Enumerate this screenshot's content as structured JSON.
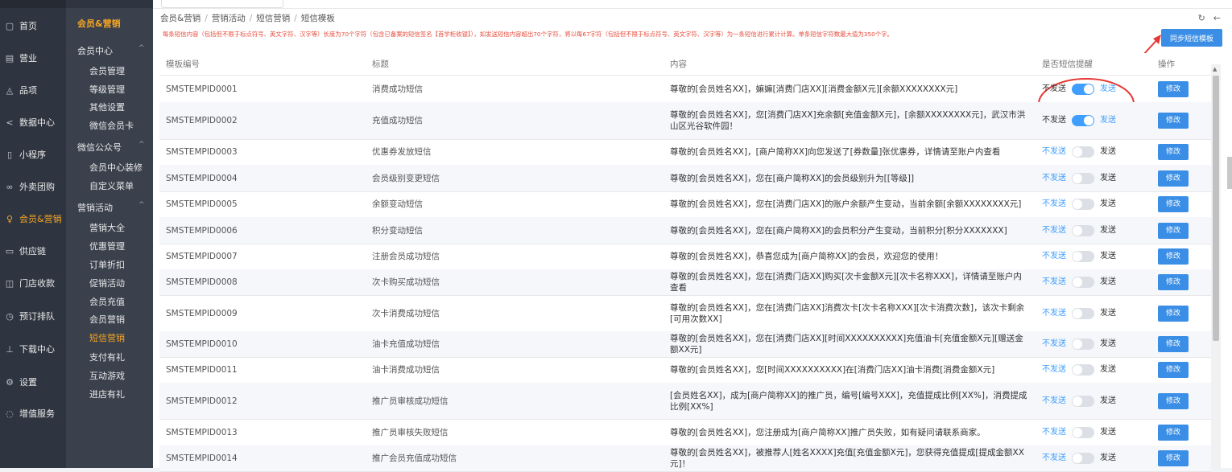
{
  "colors": {
    "accent": "#f5a623",
    "primary": "#409eff",
    "button": "#3a8ee6",
    "notice": "#e74c3c"
  },
  "nav_main": [
    {
      "label": "首页",
      "icon": "doc-icon"
    },
    {
      "label": "营业",
      "icon": "calendar-icon"
    },
    {
      "label": "品项",
      "icon": "bag-icon"
    },
    {
      "label": "数据中心",
      "icon": "share-icon"
    },
    {
      "label": "小程序",
      "icon": "phone-icon"
    },
    {
      "label": "外卖团购",
      "icon": "link-icon"
    },
    {
      "label": "会员&营销",
      "icon": "user-icon",
      "active": true
    },
    {
      "label": "供应链",
      "icon": "truck-icon"
    },
    {
      "label": "门店收款",
      "icon": "wallet-icon"
    },
    {
      "label": "预订排队",
      "icon": "clock-icon"
    },
    {
      "label": "下载中心",
      "icon": "download-icon"
    },
    {
      "label": "设置",
      "icon": "gear-icon"
    },
    {
      "label": "增值服务",
      "icon": "gift-icon"
    }
  ],
  "nav_sub": {
    "title": "会员&营销",
    "groups": [
      {
        "label": "会员中心",
        "items": [
          "会员管理",
          "等级管理",
          "其他设置",
          "微信会员卡"
        ]
      },
      {
        "label": "微信公众号",
        "items": [
          "会员中心装修",
          "自定义菜单"
        ]
      },
      {
        "label": "营销活动",
        "items": [
          "营销大全",
          "优惠管理",
          "订单折扣",
          "促销活动",
          "会员充值",
          "会员营销",
          "短信营销",
          "支付有礼",
          "互动游戏",
          "进店有礼"
        ]
      }
    ],
    "active_item": "短信营销"
  },
  "breadcrumb": [
    "会员&营销",
    "营销活动",
    "短信营销",
    "短信模板"
  ],
  "notice": "每条短信内容（包括但不限于标点符号、英文字符、汉字等）长度为70个字符（包含已备案的短信签名【首学柜收银】），如发送短信内容超出70个字符，将以每67字符（包括但不限于标点符号、英文字符、汉字等）为一条短信进行累计计算。单条短信字符数最大值为350个字。",
  "sync_button": "同步短信模板",
  "table": {
    "headers": [
      "模板编号",
      "标题",
      "内容",
      "是否短信提醒",
      "操作"
    ],
    "off_label": "不发送",
    "on_label": "发送",
    "edit_label": "修改",
    "rows": [
      {
        "id": "SMSTEMPID0001",
        "title": "消费成功短信",
        "content": "尊敬的[会员姓名XX]，嫲嫲[消费门店XX][消费金额X元][余额XXXXXXXX元]",
        "send": true
      },
      {
        "id": "SMSTEMPID0002",
        "title": "充值成功短信",
        "content": "尊敬的[会员姓名XX]，您[消费门店XX]充余额[充值金额X元]，[余额XXXXXXXX元]，武汉市洪山区光谷软件园！",
        "send": true
      },
      {
        "id": "SMSTEMPID0003",
        "title": "优惠券发放短信",
        "content": "尊敬的[会员姓名XX]，[商户简称XX]向您发送了[券数量]张优惠券，详情请至账户内查看",
        "send": false
      },
      {
        "id": "SMSTEMPID0004",
        "title": "会员级别变更短信",
        "content": "尊敬的[会员姓名XX]，您在[商户简称XX]的会员级别升为[[等级]]",
        "send": false
      },
      {
        "id": "SMSTEMPID0005",
        "title": "余额变动短信",
        "content": "尊敬的[会员姓名XX]，您在[消费门店XX]的账户余额产生变动，当前余额[余额XXXXXXXX元]",
        "send": false
      },
      {
        "id": "SMSTEMPID0006",
        "title": "积分变动短信",
        "content": "尊敬的[会员姓名XX]，您在[商户简称XX]的会员积分产生变动，当前积分[积分XXXXXXX]",
        "send": false
      },
      {
        "id": "SMSTEMPID0007",
        "title": "注册会员成功短信",
        "content": "尊敬的[会员姓名XX]，恭喜您成为[商户简称XX]的会员，欢迎您的使用！",
        "send": false
      },
      {
        "id": "SMSTEMPID0008",
        "title": "次卡购买成功短信",
        "content": "尊敬的[会员姓名XX]，您在[消费门店XX]购买[次卡金额X元][次卡名称XXX]，详情请至账户内查看",
        "send": false
      },
      {
        "id": "SMSTEMPID0009",
        "title": "次卡消费成功短信",
        "content": "尊敬的[会员姓名XX]，您在[消费门店XX]消费次卡[次卡名称XXX][次卡消费次数]，该次卡剩余[可用次数XX]",
        "send": false
      },
      {
        "id": "SMSTEMPID0010",
        "title": "油卡充值成功短信",
        "content": "尊敬的[会员姓名XX]，您在[消费门店XX][时间XXXXXXXXXX]充值油卡[充值金额X元][赠送金额XX元]",
        "send": false
      },
      {
        "id": "SMSTEMPID0011",
        "title": "油卡消费成功短信",
        "content": "尊敬的[会员姓名XX]，您[时间XXXXXXXXXX]在[消费门店XX]油卡消费[消费金额X元]",
        "send": false
      },
      {
        "id": "SMSTEMPID0012",
        "title": "推广员审核成功短信",
        "content": "[会员姓名XX]，成为[商户简称XX]的推广员，编号[编号XXX]，充值提成比例[XX%]，消费提成比例[XX%]",
        "send": false
      },
      {
        "id": "SMSTEMPID0013",
        "title": "推广员审核失败短信",
        "content": "尊敬的[会员姓名XX]，您注册成为[商户简称XX]推广员失败，如有疑问请联系商家。",
        "send": false
      },
      {
        "id": "SMSTEMPID0014",
        "title": "推广会员充值成功短信",
        "content": "尊敬的[会员姓名XX]，被推荐人[姓名XXXX]充值[充值金额X元]，您获得充值提成[提成金额XX元]！",
        "send": false
      }
    ]
  }
}
